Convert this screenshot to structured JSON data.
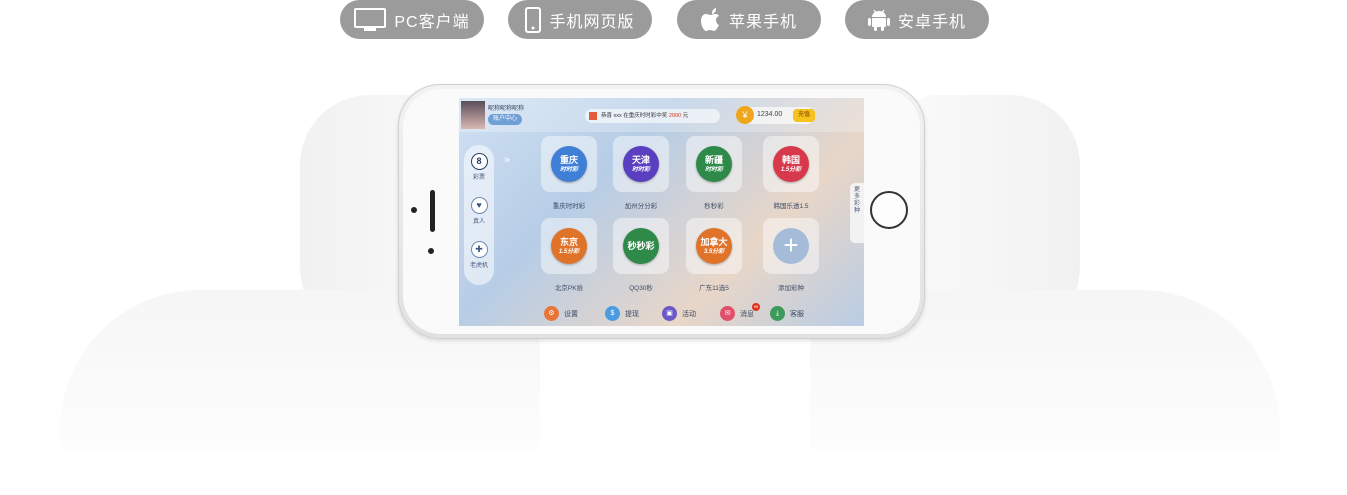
{
  "platforms": [
    {
      "label": "PC客户端",
      "icon": "monitor-icon"
    },
    {
      "label": "手机网页版",
      "icon": "smartphone-icon"
    },
    {
      "label": "苹果手机",
      "icon": "apple-icon"
    },
    {
      "label": "安卓手机",
      "icon": "android-icon"
    }
  ],
  "app": {
    "nickname": "昵称昵称昵称",
    "user_center": "账户中心",
    "marquee": {
      "prefix": "恭喜  xxx  在重庆时时彩中奖",
      "amount": "2000",
      "unit": "元"
    },
    "balance": "1234.00",
    "currency_symbol": "¥",
    "recharge": "充值",
    "sidebar": [
      {
        "label": "彩票",
        "icon": "lottery-8-icon"
      },
      {
        "label": "真人",
        "icon": "heart-icon"
      },
      {
        "label": "老虎机",
        "icon": "gamepad-icon"
      }
    ],
    "games": [
      {
        "ball_line1": "重庆",
        "ball_line2": "时时彩",
        "name": "重庆时时彩",
        "color": "#3f7fd6"
      },
      {
        "ball_line1": "天津",
        "ball_line2": "时时彩",
        "name": "加州分分彩",
        "color": "#5a3fc0"
      },
      {
        "ball_line1": "新疆",
        "ball_line2": "时时彩",
        "name": "秒秒彩",
        "color": "#2f8a4a"
      },
      {
        "ball_line1": "韩国",
        "ball_line2": "1.5分彩",
        "name": "韩国乐透1.5",
        "color": "#d8384c"
      },
      {
        "ball_line1": "东京",
        "ball_line2": "1.5分彩",
        "name": "北京PK拾",
        "color": "#e0732a"
      },
      {
        "ball_line1": "秒秒彩",
        "ball_line2": "",
        "name": "QQ30秒",
        "color": "#2f8a4a"
      },
      {
        "ball_line1": "加拿大",
        "ball_line2": "3.5分彩",
        "name": "广东11选5",
        "color": "#e0732a"
      }
    ],
    "add_game": {
      "symbol": "+",
      "name": "添加彩种"
    },
    "more_games": "更多彩种",
    "bottom_bar": [
      {
        "label": "设置",
        "icon": "gear-icon",
        "color": "#e8763a"
      },
      {
        "label": "提现",
        "icon": "dollar-icon",
        "color": "#4a9be0"
      },
      {
        "label": "活动",
        "icon": "gift-icon",
        "color": "#6a5ac8"
      },
      {
        "label": "消息",
        "icon": "mail-icon",
        "color": "#e0506a",
        "badge": "99"
      },
      {
        "label": "客服",
        "icon": "download-icon",
        "color": "#3e9a5a"
      }
    ]
  }
}
